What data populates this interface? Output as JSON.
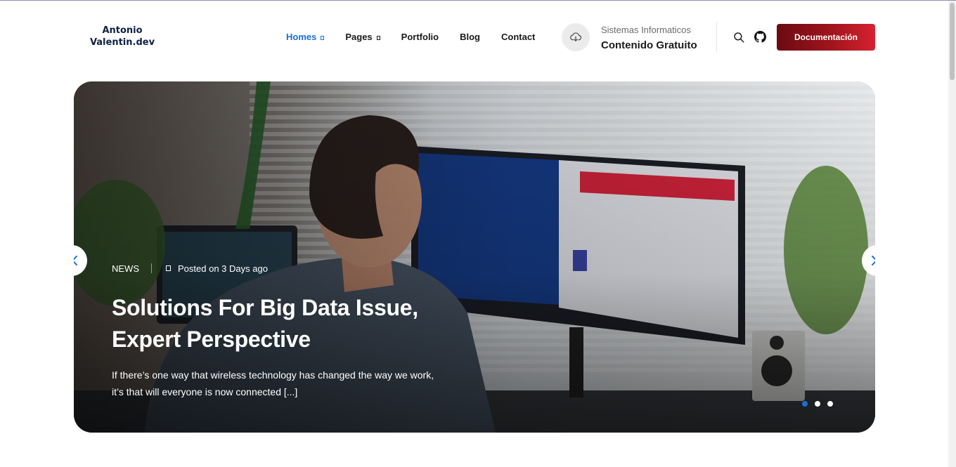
{
  "brand": {
    "line1": "Antonio",
    "line2": "Valentin.dev"
  },
  "nav": {
    "items": [
      {
        "label": "Homes",
        "has_caret": true,
        "active": true
      },
      {
        "label": "Pages",
        "has_caret": true,
        "active": false
      },
      {
        "label": "Portfolio",
        "has_caret": false,
        "active": false
      },
      {
        "label": "Blog",
        "has_caret": false,
        "active": false
      },
      {
        "label": "Contact",
        "has_caret": false,
        "active": false
      }
    ]
  },
  "info": {
    "icon": "cloud-download-icon",
    "subtitle": "Sistemas Informaticos",
    "title": "Contenido Gratuito"
  },
  "actions": {
    "search_icon": "search-icon",
    "github_icon": "github-icon",
    "cta_label": "Documentación"
  },
  "hero": {
    "category": "NEWS",
    "posted": "Posted on 3 Days ago",
    "title_line1": "Solutions For Big Data Issue,",
    "title_line2": "Expert Perspective",
    "excerpt_line1": "If there’s one way that wireless technology has changed the way we work,",
    "excerpt_line2": "it’s that will everyone is now connected [...]",
    "slides": 3,
    "active_slide": 0
  },
  "colors": {
    "accent": "#1a6ed8",
    "brand_dark": "#0e2144",
    "cta_start": "#6b0a12",
    "cta_end": "#d62230"
  }
}
